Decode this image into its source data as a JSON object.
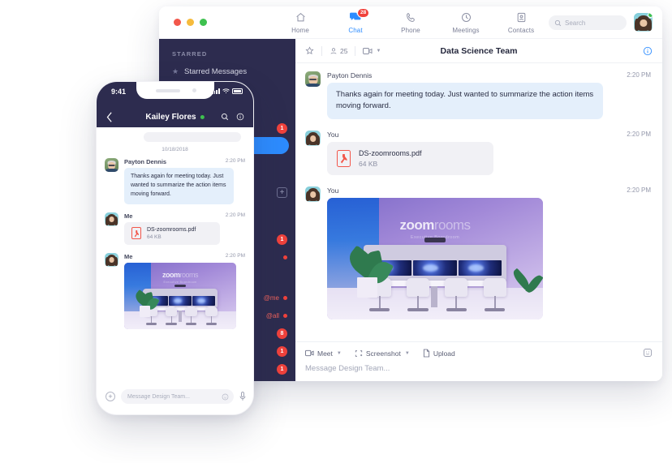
{
  "desktop": {
    "nav": {
      "tabs": [
        {
          "label": "Home",
          "icon": "home-icon",
          "active": false,
          "badge": ""
        },
        {
          "label": "Chat",
          "icon": "chat-icon",
          "active": true,
          "badge": "28"
        },
        {
          "label": "Phone",
          "icon": "phone-icon",
          "active": false,
          "badge": ""
        },
        {
          "label": "Meetings",
          "icon": "clock-icon",
          "active": false,
          "badge": ""
        },
        {
          "label": "Contacts",
          "icon": "contacts-icon",
          "active": false,
          "badge": ""
        }
      ],
      "search_placeholder": "Search",
      "avatar": "user-avatar",
      "online_status": "online"
    },
    "sidebar": {
      "section_label": "STARRED",
      "starred_item": "Starred Messages",
      "rows": [
        {
          "label": "",
          "badge": "1",
          "type": "badge"
        },
        {
          "label": "",
          "badge": "",
          "type": "selected"
        },
        {
          "label": "",
          "badge": "",
          "type": "plus"
        },
        {
          "label": "",
          "badge": "1",
          "type": "badge"
        },
        {
          "label": "",
          "badge": "",
          "type": "dot"
        },
        {
          "label": "@me",
          "badge": "",
          "type": "mention"
        },
        {
          "label": "@all",
          "badge": "",
          "type": "mention"
        },
        {
          "label": "",
          "badge": "8",
          "type": "badge"
        },
        {
          "label": "",
          "badge": "1",
          "type": "badge"
        },
        {
          "label": "",
          "badge": "1",
          "type": "badge"
        }
      ]
    },
    "chat_header": {
      "member_count": "25",
      "title": "Data Science Team",
      "star_icon": "star-icon",
      "members_icon": "people-icon",
      "video_icon": "video-icon",
      "info_icon": "info-icon"
    },
    "messages": [
      {
        "sender": "Payton Dennis",
        "time": "2:20 PM",
        "type": "text",
        "text": "Thanks again for meeting today. Just wanted to summarize the action items moving forward.",
        "avatar": "payton-avatar"
      },
      {
        "sender": "You",
        "time": "2:20 PM",
        "type": "file",
        "file_name": "DS-zoomrooms.pdf",
        "file_size": "64 KB",
        "avatar": "you-avatar"
      },
      {
        "sender": "You",
        "time": "2:20 PM",
        "type": "image",
        "image_logo": "zoom",
        "image_logo_light": "rooms",
        "image_caption": "Executive Boardroom",
        "avatar": "you-avatar"
      }
    ],
    "compose": {
      "meet_label": "Meet",
      "screenshot_label": "Screenshot",
      "upload_label": "Upload",
      "placeholder": "Message Design Team...",
      "emoji_icon": "emoji-icon"
    }
  },
  "mobile": {
    "status_time": "9:41",
    "nav_title": "Kailey Flores",
    "back_icon": "chevron-left-icon",
    "search_icon": "search-icon",
    "info_icon": "info-icon",
    "date_separator": "10/18/2018",
    "messages": [
      {
        "sender": "Payton Dennis",
        "time": "2:20 PM",
        "type": "text",
        "text": "Thanks again for meeting today. Just wanted to summarize the action items moving forward.",
        "avatar": "payton-avatar"
      },
      {
        "sender": "Me",
        "time": "2:20 PM",
        "type": "file",
        "file_name": "DS-zoomrooms.pdf",
        "file_size": "64 KB",
        "avatar": "you-avatar"
      },
      {
        "sender": "Me",
        "time": "2:20 PM",
        "type": "image",
        "image_logo": "zoom",
        "image_logo_light": "rooms",
        "image_caption": "Executive Boardroom",
        "avatar": "you-avatar"
      }
    ],
    "compose": {
      "plus_icon": "plus-icon",
      "placeholder": "Message Design Team...",
      "emoji_icon": "emoji-icon",
      "mic_icon": "microphone-icon"
    }
  },
  "colors": {
    "accent_blue": "#2D8CFF",
    "sidebar_navy": "#2D2C4F",
    "badge_red": "#F0423C",
    "bubble_blue": "#E4EFFB",
    "online_green": "#3EC14F"
  }
}
